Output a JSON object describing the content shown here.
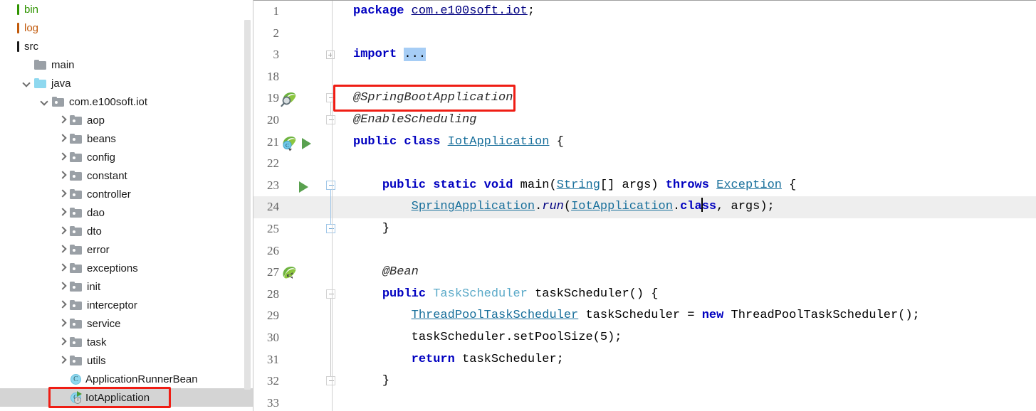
{
  "sidebar": {
    "scrollbar": {
      "name": "project-tree-scrollbar"
    },
    "items": [
      {
        "label": "bin",
        "depth": 0,
        "icon": "module-bar-icon",
        "chevron": "none",
        "color": "#2f9400",
        "selected": false
      },
      {
        "label": "log",
        "depth": 0,
        "icon": "module-bar-icon",
        "chevron": "none",
        "color": "#c1590a",
        "selected": false
      },
      {
        "label": "src",
        "depth": 0,
        "icon": "module-bar-icon",
        "chevron": "none",
        "color": "#1a1a1a",
        "selected": false
      },
      {
        "label": "main",
        "depth": 1,
        "icon": "folder-icon",
        "chevron": "none",
        "color": "#1a1a1a",
        "selected": false
      },
      {
        "label": "java",
        "depth": 1,
        "icon": "source-folder-icon",
        "chevron": "down",
        "color": "#1a1a1a",
        "selected": false
      },
      {
        "label": "com.e100soft.iot",
        "depth": 2,
        "icon": "package-icon",
        "chevron": "down",
        "color": "#1a1a1a",
        "selected": false
      },
      {
        "label": "aop",
        "depth": 3,
        "icon": "package-icon",
        "chevron": "right",
        "color": "#1a1a1a",
        "selected": false
      },
      {
        "label": "beans",
        "depth": 3,
        "icon": "package-icon",
        "chevron": "right",
        "color": "#1a1a1a",
        "selected": false
      },
      {
        "label": "config",
        "depth": 3,
        "icon": "package-icon",
        "chevron": "right",
        "color": "#1a1a1a",
        "selected": false
      },
      {
        "label": "constant",
        "depth": 3,
        "icon": "package-icon",
        "chevron": "right",
        "color": "#1a1a1a",
        "selected": false
      },
      {
        "label": "controller",
        "depth": 3,
        "icon": "package-icon",
        "chevron": "right",
        "color": "#1a1a1a",
        "selected": false
      },
      {
        "label": "dao",
        "depth": 3,
        "icon": "package-icon",
        "chevron": "right",
        "color": "#1a1a1a",
        "selected": false
      },
      {
        "label": "dto",
        "depth": 3,
        "icon": "package-icon",
        "chevron": "right",
        "color": "#1a1a1a",
        "selected": false
      },
      {
        "label": "error",
        "depth": 3,
        "icon": "package-icon",
        "chevron": "right",
        "color": "#1a1a1a",
        "selected": false
      },
      {
        "label": "exceptions",
        "depth": 3,
        "icon": "package-icon",
        "chevron": "right",
        "color": "#1a1a1a",
        "selected": false
      },
      {
        "label": "init",
        "depth": 3,
        "icon": "package-icon",
        "chevron": "right",
        "color": "#1a1a1a",
        "selected": false
      },
      {
        "label": "interceptor",
        "depth": 3,
        "icon": "package-icon",
        "chevron": "right",
        "color": "#1a1a1a",
        "selected": false
      },
      {
        "label": "service",
        "depth": 3,
        "icon": "package-icon",
        "chevron": "right",
        "color": "#1a1a1a",
        "selected": false
      },
      {
        "label": "task",
        "depth": 3,
        "icon": "package-icon",
        "chevron": "right",
        "color": "#1a1a1a",
        "selected": false
      },
      {
        "label": "utils",
        "depth": 3,
        "icon": "package-icon",
        "chevron": "right",
        "color": "#1a1a1a",
        "selected": false
      },
      {
        "label": "ApplicationRunnerBean",
        "depth": 3,
        "icon": "java-class-icon",
        "chevron": "none",
        "color": "#1a1a1a",
        "selected": false
      },
      {
        "label": "IotApplication",
        "depth": 3,
        "icon": "runnable-class-icon",
        "chevron": "none",
        "color": "#1a1a1a",
        "selected": true
      }
    ]
  },
  "annotations": {
    "tree_highlight_target": "IotApplication",
    "code_highlight_target": "@SpringBootApplication",
    "color": "#ef1d14"
  },
  "editor": {
    "caret_line": 24,
    "caret_column": 43,
    "highlighted_line": 24,
    "lines": [
      {
        "num": "1",
        "indent": 0,
        "fold": "none",
        "gutter": [],
        "text": "package com.e100soft.iot;"
      },
      {
        "num": "2",
        "indent": 0,
        "fold": "none",
        "gutter": [],
        "text": ""
      },
      {
        "num": "3",
        "indent": 0,
        "fold": "plus",
        "gutter": [],
        "text": "import ..."
      },
      {
        "num": "18",
        "indent": 0,
        "fold": "none",
        "gutter": [],
        "text": ""
      },
      {
        "num": "19",
        "indent": 0,
        "fold": "minus-cap-down",
        "gutter": [
          "spring-bean-search-icon"
        ],
        "text": "@SpringBootApplication"
      },
      {
        "num": "20",
        "indent": 0,
        "fold": "minus-cap-up",
        "gutter": [],
        "text": "@EnableScheduling"
      },
      {
        "num": "21",
        "indent": 0,
        "fold": "none",
        "gutter": [
          "spring-boot-config-icon",
          "run-icon"
        ],
        "text": "public class IotApplication {"
      },
      {
        "num": "22",
        "indent": 1,
        "fold": "none",
        "gutter": [],
        "text": ""
      },
      {
        "num": "23",
        "indent": 1,
        "fold": "minus-blue-down",
        "gutter": [
          "run-icon"
        ],
        "text": "public static void main(String[] args) throws Exception {"
      },
      {
        "num": "24",
        "indent": 2,
        "fold": "line-blue",
        "gutter": [],
        "text": "SpringApplication.run(IotApplication.class, args);"
      },
      {
        "num": "25",
        "indent": 1,
        "fold": "minus-blue-up",
        "gutter": [],
        "text": "}"
      },
      {
        "num": "26",
        "indent": 1,
        "fold": "none",
        "gutter": [],
        "text": ""
      },
      {
        "num": "27",
        "indent": 1,
        "fold": "none",
        "gutter": [
          "spring-bean-icon"
        ],
        "text": "@Bean"
      },
      {
        "num": "28",
        "indent": 1,
        "fold": "minus-down",
        "gutter": [],
        "text": "public TaskScheduler taskScheduler() {"
      },
      {
        "num": "29",
        "indent": 2,
        "fold": "line",
        "gutter": [],
        "text": "ThreadPoolTaskScheduler taskScheduler = new ThreadPoolTaskScheduler();"
      },
      {
        "num": "30",
        "indent": 2,
        "fold": "line",
        "gutter": [],
        "text": "taskScheduler.setPoolSize(5);"
      },
      {
        "num": "31",
        "indent": 2,
        "fold": "line",
        "gutter": [],
        "text": "return taskScheduler;"
      },
      {
        "num": "32",
        "indent": 1,
        "fold": "minus-up",
        "gutter": [],
        "text": "}"
      },
      {
        "num": "33",
        "indent": 0,
        "fold": "none",
        "gutter": [],
        "text": ""
      }
    ],
    "tokens": {
      "line1": [
        "package ",
        "com.e100soft.iot",
        ";"
      ],
      "line3": [
        "import ",
        "..."
      ],
      "line19": "@SpringBootApplication",
      "line20": "@EnableScheduling",
      "line21": [
        "public",
        "class",
        "IotApplication",
        "{"
      ],
      "line23": [
        "public",
        "static",
        "void",
        "main(",
        "String",
        "[] args) ",
        "throws",
        " ",
        "Exception",
        " {"
      ],
      "line24": [
        "SpringApplication",
        ".",
        "run",
        "(",
        "IotApplication",
        ".",
        "class",
        ", args);"
      ],
      "line25": "}",
      "line27": "@Bean",
      "line28": [
        "public",
        "TaskScheduler",
        "taskScheduler() {"
      ],
      "line29": [
        "ThreadPoolTaskScheduler",
        " taskScheduler = ",
        "new",
        " ThreadPoolTaskScheduler();"
      ],
      "line30": "taskScheduler.setPoolSize(5);",
      "line31": [
        "return",
        " taskScheduler;"
      ],
      "line32": "}"
    }
  },
  "colors": {
    "keyword": "#0000c0",
    "reference": "#000080",
    "class_ref": "#186f9b",
    "type": "#5aa9c8",
    "annotation": "#2b2b2b",
    "selection": "#a6cdf5",
    "current_line": "#eeeeee",
    "tree_selection": "#d4d4d4",
    "annotation_box": "#ef1d14"
  }
}
